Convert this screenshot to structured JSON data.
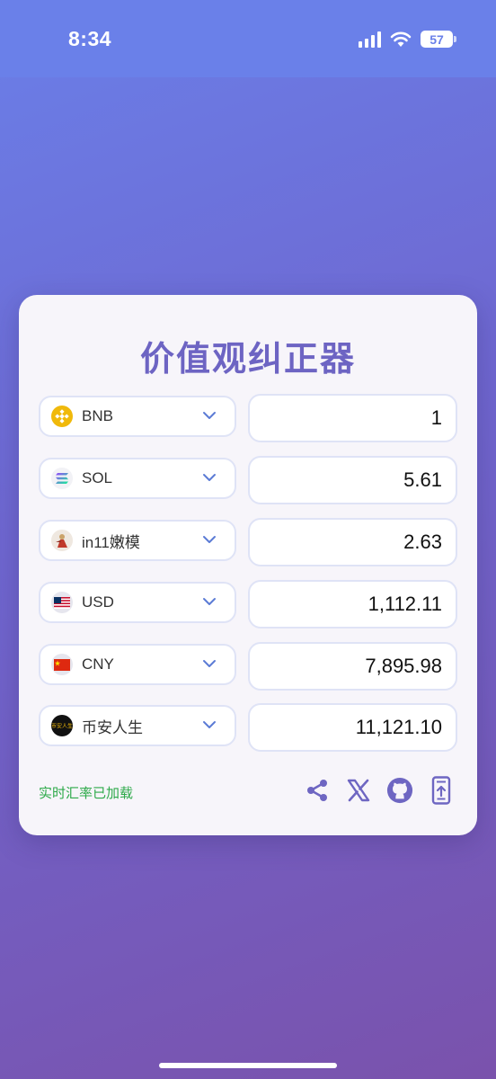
{
  "status_bar": {
    "time": "8:34",
    "battery": "57"
  },
  "title": "价值观纠正器",
  "rows": [
    {
      "currency": "BNB",
      "value": "1",
      "icon": "bnb-coin-icon"
    },
    {
      "currency": "SOL",
      "value": "5.61",
      "icon": "sol-coin-icon"
    },
    {
      "currency": "in11嫩模",
      "value": "2.63",
      "icon": "in11-avatar-icon"
    },
    {
      "currency": "USD",
      "value": "1,112.11",
      "icon": "us-flag-icon"
    },
    {
      "currency": "CNY",
      "value": "7,895.98",
      "icon": "cn-flag-icon"
    },
    {
      "currency": "币安人生",
      "value": "11,121.10",
      "icon": "binance-life-icon"
    }
  ],
  "coin_badge_text": "币安人生",
  "footer": {
    "status": "实时汇率已加载"
  },
  "colors": {
    "accent": "#6d64c3",
    "status_green": "#2eaa4a",
    "icon_purple": "#6e66c2"
  }
}
